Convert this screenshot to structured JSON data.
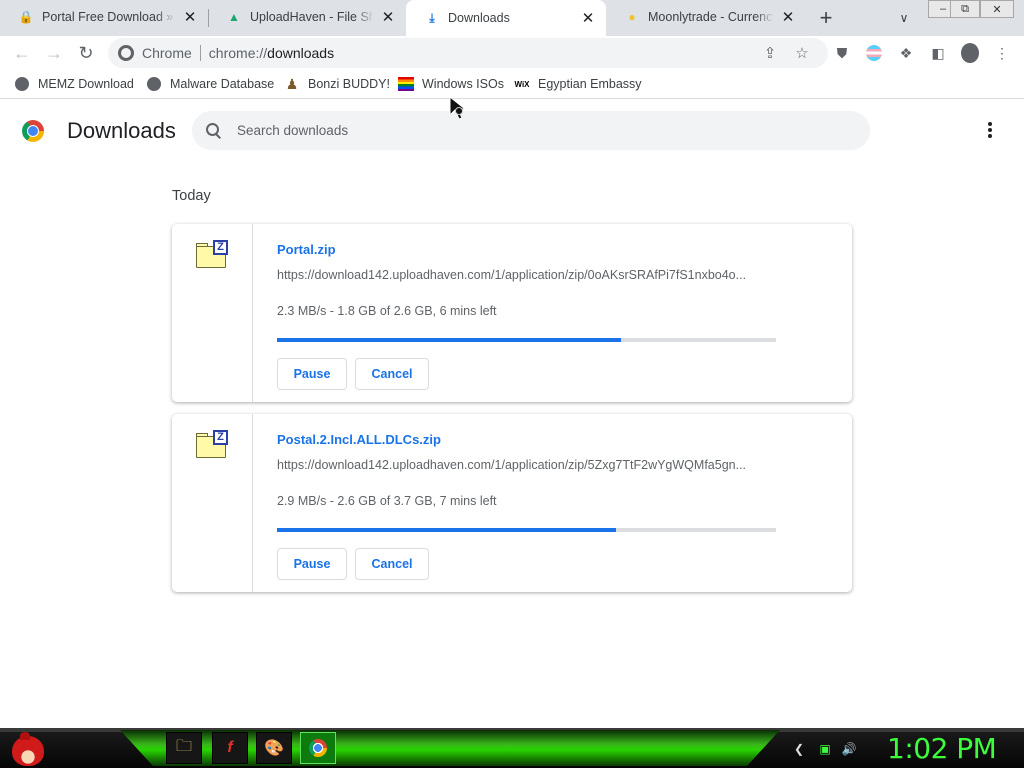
{
  "tabs": [
    {
      "title": "Portal Free Download » SteamUnlocked",
      "icon": "lock-icon",
      "color": "#d93025"
    },
    {
      "title": "UploadHaven - File Sharing",
      "icon": "uploadhaven-icon",
      "color": "#1ea672"
    },
    {
      "title": "Downloads",
      "icon": "download-icon",
      "color": "#1a73e8"
    },
    {
      "title": "Moonlytrade - Currency Exchange",
      "icon": "moon-icon",
      "color": "#f0c330"
    }
  ],
  "toolbar": {
    "chip_label": "Chrome",
    "url_scheme": "chrome://",
    "url_path": "downloads"
  },
  "bookmarks": [
    {
      "label": "MEMZ Download",
      "icon": "globe-icon"
    },
    {
      "label": "Malware Database",
      "icon": "globe-icon"
    },
    {
      "label": "Bonzi BUDDY!",
      "icon": "bonzi-icon"
    },
    {
      "label": "Windows ISOs",
      "icon": "rainbow-flag-icon"
    },
    {
      "label": "Egyptian Embassy",
      "icon": "wix-icon"
    }
  ],
  "page": {
    "title": "Downloads",
    "search_placeholder": "Search downloads",
    "section_date": "Today"
  },
  "downloads": [
    {
      "file_name": "Portal.zip",
      "url": "https://download142.uploadhaven.com/1/application/zip/0oAKsrSRAfPi7fS1nxbo4o...",
      "status": "2.3 MB/s - 1.8 GB of 2.6 GB, 6 mins left",
      "progress": 0.69,
      "pause_label": "Pause",
      "cancel_label": "Cancel"
    },
    {
      "file_name": "Postal.2.Incl.ALL.DLCs.zip",
      "url": "https://download142.uploadhaven.com/1/application/zip/5Zxg7TtF2wYgWQMfa5gn...",
      "status": "2.9 MB/s - 2.6 GB of 3.7 GB, 7 mins left",
      "progress": 0.68,
      "pause_label": "Pause",
      "cancel_label": "Cancel"
    }
  ],
  "taskbar": {
    "clock": "1:02 PM",
    "accent": "#3cff3c"
  }
}
